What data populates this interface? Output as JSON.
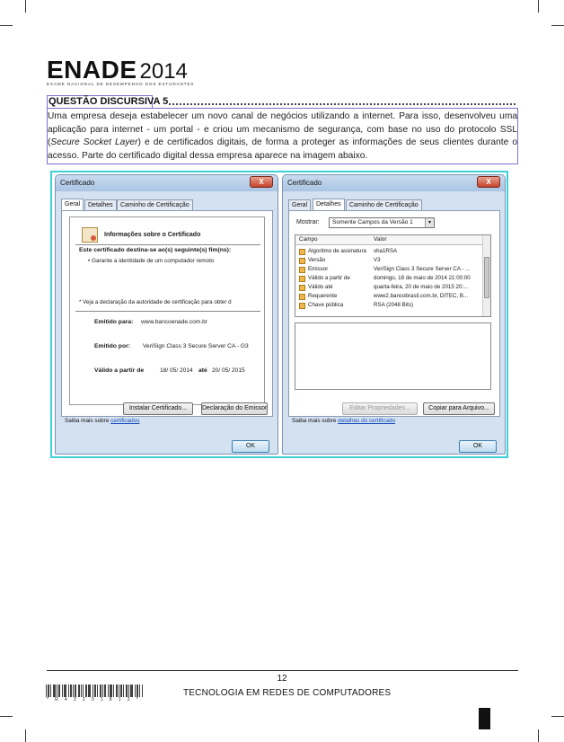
{
  "header": {
    "logo": "ENADE",
    "year": "2014",
    "subtitle": "EXAME NACIONAL DE DESEMPENHO DOS ESTUDANTES"
  },
  "question": {
    "title": "QUESTÃO DISCURSIVA 5",
    "text_1": "Uma empresa deseja estabelecer um novo canal de negócios utilizando a internet. Para isso, desenvolveu uma aplicação para internet - um portal - e criou um mecanismo de segurança, com base no uso do protocolo SSL (",
    "text_italic": "Secure Socket Layer",
    "text_2": ") e de certificados digitais, de forma a proteger as informações de seus clientes durante o acesso. Parte do certificado digital dessa empresa aparece na imagem abaixo."
  },
  "left_window": {
    "title": "Certificado",
    "close": "X",
    "tabs": [
      "Geral",
      "Detalhes",
      "Caminho de Certificação"
    ],
    "info_title": "Informações sobre o Certificado",
    "purpose_heading": "Este certificado destina-se ao(s) seguinte(s) fim(ns):",
    "purpose_item": "• Garante a identidade de um computador remoto",
    "note": "* Veja a declaração da autoridade de certificação para obter d",
    "issued_to_label": "Emitido para:",
    "issued_to": "www.bancoenade.com.br",
    "issued_by_label": "Emitido por:",
    "issued_by": "VeriSign Class 3 Secure Server CA - G3",
    "valid_from_label": "Válido a partir de",
    "valid_from": "18/ 05/ 2014",
    "valid_until_label": "até",
    "valid_until": "20/ 05/ 2015",
    "install_button": "Instalar Certificado...",
    "issuer_statement_button": "Declaração do Emissor",
    "learn_more": "Saiba mais sobre ",
    "learn_more_link": "certificados",
    "ok": "OK"
  },
  "right_window": {
    "title": "Certificado",
    "close": "X",
    "tabs": [
      "Geral",
      "Detalhes",
      "Caminho de Certificação"
    ],
    "show_label": "Mostrar:",
    "show_value": "Somente Campos da Versão 1",
    "col_field": "Campo",
    "col_value": "Valor",
    "rows": [
      {
        "field": "Algoritmo de assinatura",
        "value": "sha1RSA"
      },
      {
        "field": "Versão",
        "value": "V3"
      },
      {
        "field": "Emissor",
        "value": "VeriSign Class 3 Secure Server CA - ..."
      },
      {
        "field": "Válido a partir de",
        "value": "domingo, 18 de maio de 2014 21:00:00"
      },
      {
        "field": "Válido até",
        "value": "quarta-feira, 20 de maio de 2015 20:..."
      },
      {
        "field": "Requerente",
        "value": "www2.bancobrasil.com.br, DITEC, B..."
      },
      {
        "field": "Chave pública",
        "value": "RSA (2048 Bits)"
      }
    ],
    "edit_button": "Editar Propriedades...",
    "copy_button": "Copiar para Arquivo...",
    "learn_more": "Saiba mais sobre ",
    "learn_more_link": "detalhes do certificado",
    "ok": "OK"
  },
  "footer": {
    "page": "12",
    "course": "TECNOLOGIA EM REDES DE COMPUTADORES",
    "barcode_text": "* R 4 3 2 0 1 8 1 2 *"
  }
}
